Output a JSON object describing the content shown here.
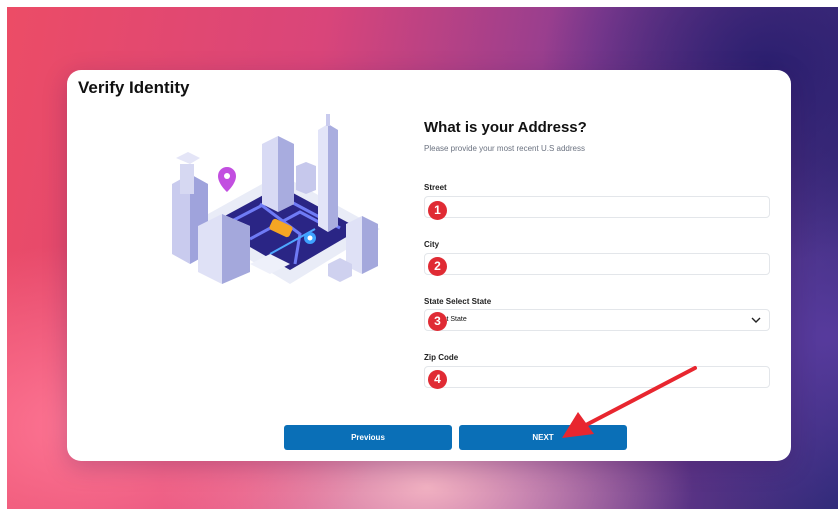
{
  "card": {
    "title": "Verify Identity"
  },
  "form": {
    "heading": "What is your Address?",
    "subheading": "Please provide your most recent U.S address",
    "street_label": "Street",
    "city_label": "City",
    "state_label": "State Select State",
    "state_value": "ct State",
    "zip_label": "Zip Code"
  },
  "badges": [
    "1",
    "2",
    "3",
    "4"
  ],
  "buttons": {
    "previous": "Previous",
    "next": "NEXT"
  },
  "icons": {
    "select": "chevron-down-icon",
    "illustration": "city-map-illustration",
    "annotation": "red-arrow"
  },
  "colors": {
    "accent": "#0a6fb7",
    "badge": "#e02b34",
    "arrow": "#e8262f"
  }
}
